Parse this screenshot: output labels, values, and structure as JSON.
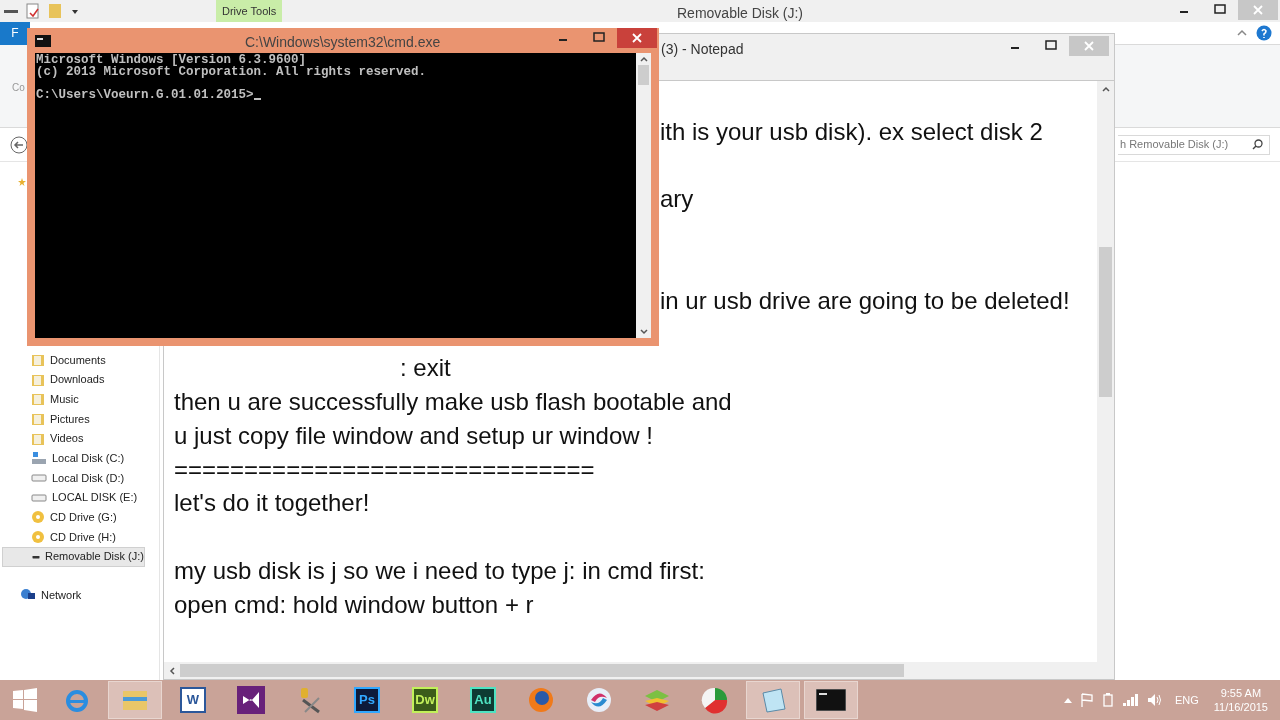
{
  "explorer": {
    "title": "Removable Disk (J:)",
    "context_tab": "Drive Tools",
    "file_tab": "F",
    "ribbon_label": "Co",
    "search": {
      "placeholder": "h Removable Disk (J:)"
    },
    "sidebar": [
      {
        "label": "Documents",
        "kind": "folder",
        "selected": false
      },
      {
        "label": "Downloads",
        "kind": "folder",
        "selected": false
      },
      {
        "label": "Music",
        "kind": "folder",
        "selected": false
      },
      {
        "label": "Pictures",
        "kind": "folder",
        "selected": false
      },
      {
        "label": "Videos",
        "kind": "folder",
        "selected": false
      },
      {
        "label": "Local Disk (C:)",
        "kind": "system-drive",
        "selected": false
      },
      {
        "label": "Local Disk (D:)",
        "kind": "drive",
        "selected": false
      },
      {
        "label": "LOCAL DISK (E:)",
        "kind": "drive",
        "selected": false
      },
      {
        "label": "CD Drive (G:)",
        "kind": "cd",
        "selected": false
      },
      {
        "label": "CD Drive (H:)",
        "kind": "cd",
        "selected": false
      },
      {
        "label": "Removable Disk (J:)",
        "kind": "usb",
        "selected": true
      },
      {
        "label": "Network",
        "kind": "network",
        "selected": false
      }
    ]
  },
  "notepad": {
    "title": "(3) - Notepad",
    "lines": [
      {
        "kind": "blank"
      },
      {
        "kind": "clipped",
        "text": "ith is your usb disk). ex select disk 2"
      },
      {
        "kind": "blank"
      },
      {
        "kind": "clipped",
        "text": "ary"
      },
      {
        "kind": "blank"
      },
      {
        "kind": "blank"
      },
      {
        "kind": "clipped",
        "text": "in ur usb drive are going to be deleted!"
      },
      {
        "kind": "blank"
      },
      {
        "kind": "indented",
        "text": ": exit"
      },
      {
        "kind": "plain",
        "text": "then u are successfully make usb flash bootable and"
      },
      {
        "kind": "plain",
        "text": "u just copy file window and setup ur window !"
      },
      {
        "kind": "plain",
        "text": "=============================="
      },
      {
        "kind": "plain",
        "text": "let's do it together!"
      },
      {
        "kind": "blank"
      },
      {
        "kind": "plain",
        "text": "my usb disk is j so we i need to type j: in cmd first:"
      },
      {
        "kind": "plain",
        "text": "open cmd: hold window button + r"
      }
    ]
  },
  "cmd": {
    "title": "C:\\Windows\\system32\\cmd.exe",
    "lines": [
      {
        "kind": "output",
        "text": "Microsoft Windows [Version 6.3.9600]"
      },
      {
        "kind": "output",
        "text": "(c) 2013 Microsoft Corporation. All rights reserved."
      },
      {
        "kind": "prompt",
        "text": "C:\\Users\\Voeurn.G.01.01.2015>"
      }
    ]
  },
  "taskbar": {
    "apps": [
      {
        "kind": "ie",
        "active": false
      },
      {
        "kind": "explorer",
        "active": true
      },
      {
        "kind": "word",
        "label": "W",
        "active": false
      },
      {
        "kind": "vs",
        "active": false
      },
      {
        "kind": "tool",
        "active": false
      },
      {
        "kind": "ps",
        "label": "Ps",
        "active": false
      },
      {
        "kind": "dw",
        "label": "Dw",
        "active": false
      },
      {
        "kind": "au",
        "label": "Au",
        "active": false
      },
      {
        "kind": "firefox",
        "active": false
      },
      {
        "kind": "swirl",
        "active": false
      },
      {
        "kind": "stack",
        "active": false
      },
      {
        "kind": "pie",
        "active": false
      },
      {
        "kind": "notepad",
        "active": true
      },
      {
        "kind": "cmd",
        "active": true
      }
    ],
    "language": "ENG",
    "time": "9:55 AM",
    "date": "11/16/2015"
  }
}
